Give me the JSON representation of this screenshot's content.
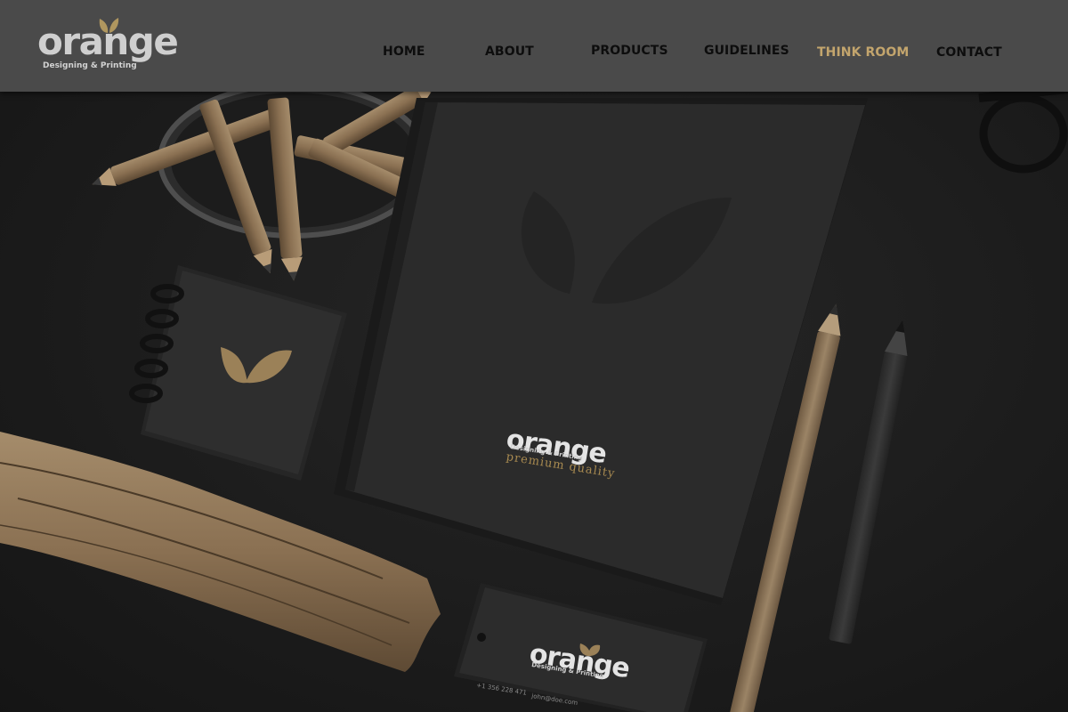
{
  "brand": {
    "name": "orange",
    "tagline": "Designing & Printing",
    "accent_color": "#c3a56d",
    "logo_text_color": "#cfcfcf"
  },
  "nav": {
    "items": [
      {
        "label": "HOME",
        "active": false
      },
      {
        "label": "ABOUT",
        "active": false
      },
      {
        "label": "PRODUCTS",
        "active": false
      },
      {
        "label": "GUIDELINES",
        "active": false
      },
      {
        "label": "THINK ROOM",
        "active": true
      },
      {
        "label": "CONTACT",
        "active": false
      }
    ]
  },
  "hero": {
    "notebook": {
      "logo_word": "orange",
      "logo_tagline": "Designing & Printing",
      "slogan": "premium quality"
    },
    "card": {
      "logo_word": "orange",
      "logo_tagline": "Designing & Printing",
      "phone": "+1 356 228 471",
      "email": "john@doe.com"
    }
  },
  "colors": {
    "header_bg": "#4a4a4a",
    "page_bg": "#1b1b1b",
    "nav_text": "#0d0d0d",
    "nav_active": "#c3a56d"
  }
}
